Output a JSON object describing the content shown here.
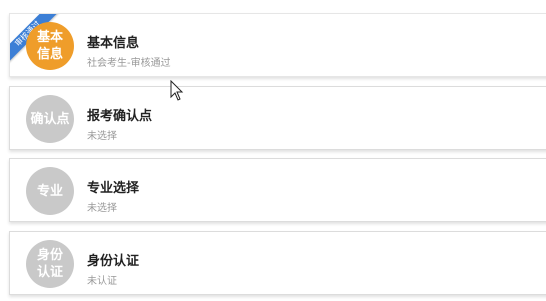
{
  "colors": {
    "active_circle": "#ef9d2a",
    "inactive_circle": "#c9c9c9",
    "ribbon": "#3c7fd6"
  },
  "steps": [
    {
      "icon_text": "基本\n信息",
      "title": "基本信息",
      "status": "社会考生-审核通过",
      "ribbon": "审核通过",
      "active": true
    },
    {
      "icon_text": "确认点",
      "title": "报考确认点",
      "status": "未选择",
      "active": false
    },
    {
      "icon_text": "专业",
      "title": "专业选择",
      "status": "未选择",
      "active": false
    },
    {
      "icon_text": "身份\n认证",
      "title": "身份认证",
      "status": "未认证",
      "active": false
    }
  ]
}
